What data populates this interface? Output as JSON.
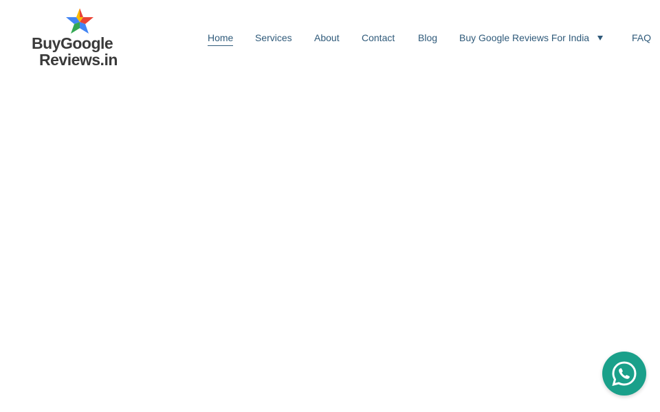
{
  "logo": {
    "line1": "BuyGoogle",
    "line2": "Reviews.in",
    "icon": "star-logo-icon"
  },
  "nav": {
    "items": [
      {
        "label": "Home",
        "active": true
      },
      {
        "label": "Services"
      },
      {
        "label": "About"
      },
      {
        "label": "Contact"
      },
      {
        "label": "Blog"
      },
      {
        "label": "Buy Google Reviews For India",
        "dropdown": true
      },
      {
        "label": "FAQ"
      }
    ]
  },
  "colors": {
    "nav_text": "#2f5a7a",
    "whatsapp": "#1aa08a",
    "star_blue": "#4285f4",
    "star_green": "#34a853",
    "star_yellow": "#fbbc05",
    "star_red": "#ea4335"
  },
  "whatsapp": {
    "icon": "whatsapp-icon"
  }
}
